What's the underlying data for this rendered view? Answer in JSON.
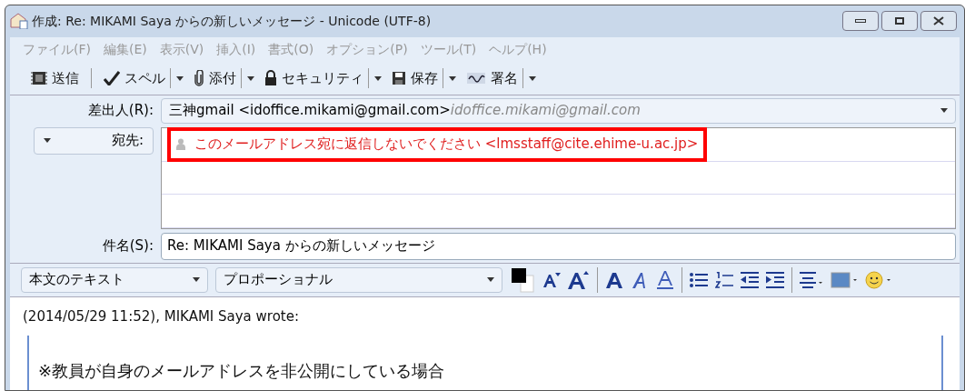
{
  "window": {
    "title": "作成: Re: MIKAMI Saya からの新しいメッセージ - Unicode (UTF-8)"
  },
  "menu": [
    "ファイル(F)",
    "編集(E)",
    "表示(V)",
    "挿入(I)",
    "書式(O)",
    "オプション(P)",
    "ツール(T)",
    "ヘルプ(H)"
  ],
  "toolbar": [
    {
      "kind": "send",
      "label": "送信",
      "dropdown": false
    },
    {
      "kind": "spell",
      "label": "スペル",
      "dropdown": true
    },
    {
      "kind": "attach",
      "label": "添付",
      "dropdown": true
    },
    {
      "kind": "security",
      "label": "セキュリティ",
      "dropdown": true
    },
    {
      "kind": "save",
      "label": "保存",
      "dropdown": true
    },
    {
      "kind": "signature",
      "label": "署名",
      "dropdown": true
    }
  ],
  "from": {
    "label": "差出人(R):",
    "value": "三神gmail <idoffice.mikami@gmail.com>",
    "identity": "idoffice.mikami@gmail.com"
  },
  "recipients": {
    "type_label": "宛先:",
    "items": [
      {
        "address": "このメールアドレス宛に返信しないでください <lmsstaff@cite.ehime-u.ac.jp>",
        "highlighted": true
      }
    ]
  },
  "subject": {
    "label": "件名(S):",
    "value": "Re: MIKAMI Saya からの新しいメッセージ"
  },
  "format": {
    "paragraph": "本文のテキスト",
    "font": "プロポーショナル"
  },
  "body": {
    "attribution": "(2014/05/29 11:52), MIKAMI Saya wrote:",
    "quote": [
      "※教員が自身のメールアドレスを非公開にしている場合"
    ]
  }
}
